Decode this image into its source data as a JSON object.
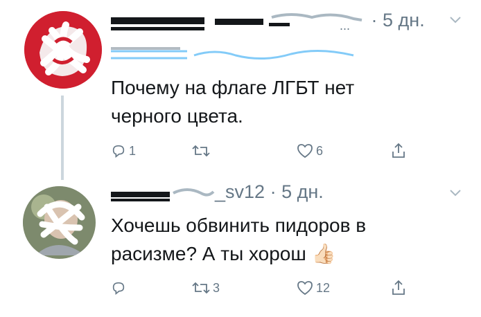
{
  "tweets": [
    {
      "time": "· 5 дн.",
      "text": "Почему на флаге ЛГБТ нет\nчерного цвета.",
      "actions": {
        "replies": "1",
        "retweets": "",
        "likes": "6"
      }
    },
    {
      "handle_fragment": "_sv12",
      "time": "· 5 дн.",
      "text": "Хочешь обвинить пидоров в\nрасизме? А ты хорош",
      "emoji": "👍🏻",
      "actions": {
        "replies": "",
        "retweets": "3",
        "likes": "12"
      }
    }
  ],
  "icons": {
    "reply": "reply-icon",
    "retweet": "retweet-icon",
    "like": "heart-icon",
    "share": "share-icon",
    "caret": "chevron-down-icon"
  },
  "colors": {
    "meta": "#657786",
    "link": "#1da1f2",
    "divider": "#ccd6dd",
    "avatar_red": "#d01f2f"
  }
}
